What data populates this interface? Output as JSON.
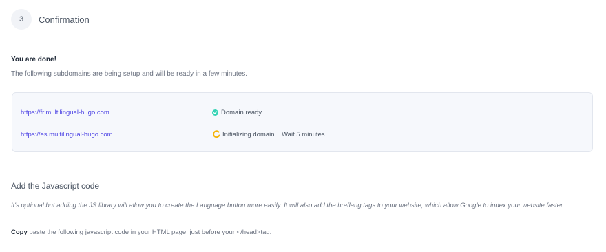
{
  "step": {
    "number": "3",
    "title": "Confirmation"
  },
  "done": {
    "title": "You are done!",
    "description": "The following subdomains are being setup and will be ready in a few minutes."
  },
  "domains": [
    {
      "url": "https://fr.multilingual-hugo.com",
      "status": "Domain ready",
      "status_icon": "check-circle-icon",
      "status_color": "#34d3b4"
    },
    {
      "url": "https://es.multilingual-hugo.com",
      "status": "Initializing domain... Wait 5 minutes",
      "status_icon": "spinner-icon",
      "status_color": "#f5b40a"
    }
  ],
  "javascript": {
    "title": "Add the Javascript code",
    "description": "It's optional but adding the JS library will allow you to create the Language button more easily. It will also add the hreflang tags to your website, which allow Google to index your website faster",
    "copy_label": "Copy",
    "copy_text": " paste the following javascript code in your HTML page, just before your </head>tag."
  },
  "colors": {
    "link": "#4f46e5",
    "box_background": "#f6f8fc",
    "box_border": "#e2e6ee"
  }
}
